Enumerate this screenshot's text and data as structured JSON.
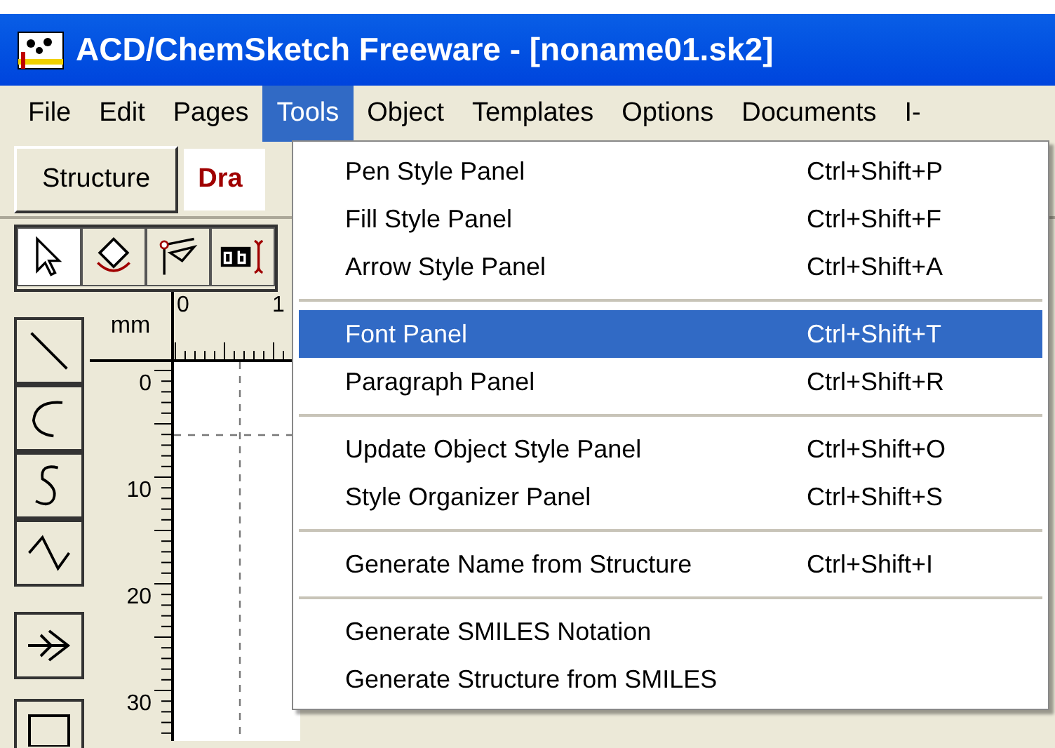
{
  "window": {
    "title": "ACD/ChemSketch Freeware - [noname01.sk2]"
  },
  "menu_bar": [
    {
      "label": "File",
      "selected": false
    },
    {
      "label": "Edit",
      "selected": false
    },
    {
      "label": "Pages",
      "selected": false
    },
    {
      "label": "Tools",
      "selected": true
    },
    {
      "label": "Object",
      "selected": false
    },
    {
      "label": "Templates",
      "selected": false
    },
    {
      "label": "Options",
      "selected": false
    },
    {
      "label": "Documents",
      "selected": false
    },
    {
      "label": "I-",
      "selected": false
    }
  ],
  "mode_tabs": [
    {
      "label": "Structure",
      "selected": false
    },
    {
      "label": "Dra",
      "selected": true
    }
  ],
  "toolbar": [
    {
      "selected": true
    },
    {
      "selected": false
    },
    {
      "selected": false
    },
    {
      "selected": false
    }
  ],
  "ruler": {
    "unit": "mm",
    "top_labels": [
      "0",
      "1"
    ],
    "left_labels": [
      "0",
      "10",
      "20",
      "30"
    ]
  },
  "tools_menu": {
    "groups": [
      {
        "items": [
          {
            "label": "Pen Style Panel",
            "shortcut": "Ctrl+Shift+P",
            "selected": false
          },
          {
            "label": "Fill Style Panel",
            "shortcut": "Ctrl+Shift+F",
            "selected": false
          },
          {
            "label": "Arrow Style Panel",
            "shortcut": "Ctrl+Shift+A",
            "selected": false
          }
        ]
      },
      {
        "items": [
          {
            "label": "Font Panel",
            "shortcut": "Ctrl+Shift+T",
            "selected": true
          },
          {
            "label": "Paragraph Panel",
            "shortcut": "Ctrl+Shift+R",
            "selected": false
          }
        ]
      },
      {
        "items": [
          {
            "label": "Update Object Style Panel",
            "shortcut": "Ctrl+Shift+O",
            "selected": false
          },
          {
            "label": "Style Organizer Panel",
            "shortcut": "Ctrl+Shift+S",
            "selected": false
          }
        ]
      },
      {
        "items": [
          {
            "label": "Generate Name from Structure",
            "shortcut": "Ctrl+Shift+I",
            "selected": false
          }
        ]
      },
      {
        "items": [
          {
            "label": "Generate SMILES Notation",
            "selected": false
          },
          {
            "label": "Generate Structure from SMILES",
            "selected": false
          }
        ]
      }
    ]
  }
}
